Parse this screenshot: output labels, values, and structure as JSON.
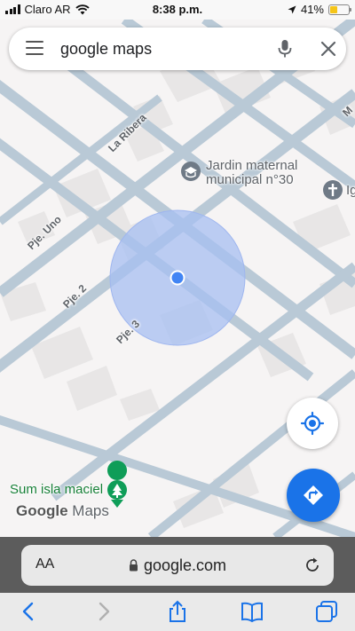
{
  "status_bar": {
    "carrier": "Claro AR",
    "time": "8:38 p.m.",
    "battery": "41%",
    "battery_level": 0.41
  },
  "search": {
    "query": "google maps",
    "icons": [
      "menu-icon",
      "mic-icon",
      "close-icon"
    ]
  },
  "map": {
    "poi_school": {
      "name_line1": "Jardin maternal",
      "name_line2": "municipal n°30",
      "icon": "school-icon"
    },
    "poi_church": {
      "name": "Ig",
      "icon": "church-icon"
    },
    "poi_park": {
      "name": "Sum isla maciel",
      "icon": "park-icon"
    },
    "streets": {
      "la_ribera": "La Ribera",
      "pje_uno": "Pje. Uno",
      "pje_2": "Pje. 2",
      "pje_3": "Pje. 3",
      "m": "M"
    },
    "logo_google": "Google",
    "logo_maps": "Maps"
  },
  "buttons": {
    "locate_icon": "my-location-icon",
    "directions_icon": "directions-icon"
  },
  "safari": {
    "aa_label": "AA",
    "url": "google.com",
    "toolbar": [
      "back-icon",
      "forward-icon",
      "share-icon",
      "bookmarks-icon",
      "tabs-icon"
    ]
  },
  "colors": {
    "road": "#b9c9d6",
    "block": "#e8e6e6",
    "accuracy_circle": "#a7bff2",
    "location_dot": "#4285f4",
    "directions": "#1a73e8",
    "safari_bar": "#5c5c5c"
  }
}
